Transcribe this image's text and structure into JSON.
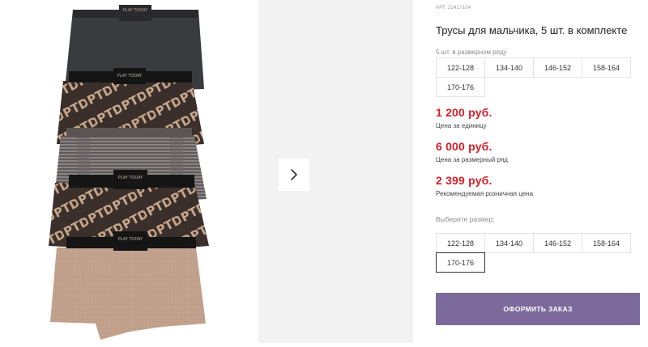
{
  "product": {
    "article": "АРТ. 22417104",
    "title": "Трусы для мальчика, 5 шт. в комплекте",
    "set_label": "5 шт. в размерном ряду",
    "set_sizes": [
      "122-128",
      "134-140",
      "146-152",
      "158-164",
      "170-176"
    ],
    "prices": [
      {
        "value": "1 200 руб.",
        "note": "Цена за единицу"
      },
      {
        "value": "6 000 руб.",
        "note": "Цена за размерный ряд"
      },
      {
        "value": "2 399 руб.",
        "note": "Рекомендуемая розничная цена"
      }
    ],
    "choose_label": "Выберите размер:",
    "choose_sizes": [
      "122-128",
      "134-140",
      "146-152",
      "158-164",
      "170-176"
    ],
    "selected_size": "170-176",
    "order_button": "ОФОРМИТЬ ЗАКАЗ",
    "waistband_text": "PLAY TODAY",
    "print_text": "PTD"
  },
  "gallery": {
    "next_icon": "chevron-right-icon"
  },
  "colors": {
    "price": "#d4202a",
    "button": "#7b6a9b",
    "thumb_panel": "#f2f2f2"
  }
}
